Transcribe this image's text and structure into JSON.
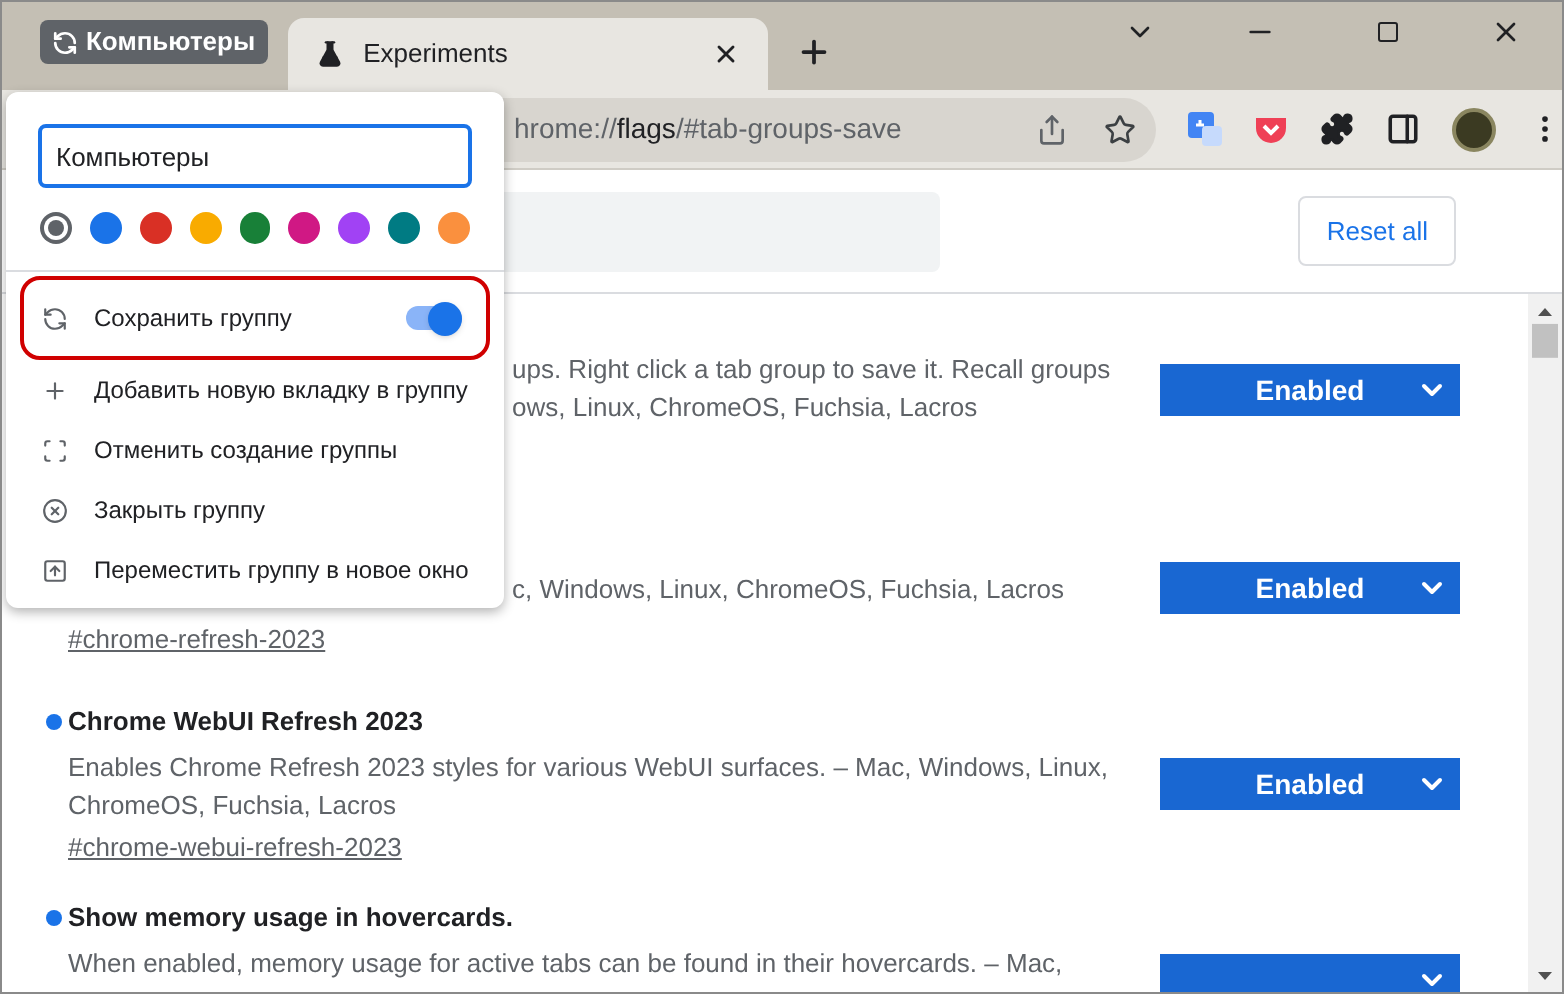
{
  "tab_group": {
    "label": "Компьютеры"
  },
  "tabs": [
    {
      "title": "Experiments",
      "selected": true
    }
  ],
  "address_bar": {
    "scheme_part": "hrome://",
    "page": "flags",
    "rest": "/#tab-groups-save"
  },
  "header": {
    "reset_button": "Reset all"
  },
  "flags": [
    {
      "kind": "covered",
      "lines": [
        "ups. Right click a tab group to save it. Recall groups",
        "ows, Linux, ChromeOS, Fuchsia, Lacros"
      ],
      "select": {
        "label": "Enabled"
      }
    },
    {
      "kind": "covered",
      "lines": [
        "c, Windows, Linux, ChromeOS, Fuchsia, Lacros"
      ],
      "link": "#chrome-refresh-2023",
      "select": {
        "label": "Enabled"
      }
    },
    {
      "kind": "full",
      "title": "Chrome WebUI Refresh 2023",
      "description": "Enables Chrome Refresh 2023 styles for various WebUI surfaces. – Mac, Windows, Linux, ChromeOS, Fuchsia, Lacros",
      "link": "#chrome-webui-refresh-2023",
      "select": {
        "label": "Enabled"
      }
    },
    {
      "kind": "full",
      "title": "Show memory usage in hovercards.",
      "description": "When enabled, memory usage for active tabs can be found in their hovercards. – Mac,"
    }
  ],
  "group_menu": {
    "name_field": {
      "value": "Компьютеры"
    },
    "colors": [
      {
        "color": "#5f6368",
        "selected": true
      },
      {
        "color": "#1a73e8",
        "selected": false
      },
      {
        "color": "#d93025",
        "selected": false
      },
      {
        "color": "#f9ab00",
        "selected": false
      },
      {
        "color": "#188038",
        "selected": false
      },
      {
        "color": "#d01884",
        "selected": false
      },
      {
        "color": "#a142f4",
        "selected": false
      },
      {
        "color": "#007b83",
        "selected": false
      },
      {
        "color": "#fa903e",
        "selected": false
      }
    ],
    "items": [
      {
        "kind": "toggle",
        "label": "Сохранить группу",
        "on": true,
        "highlighted": true
      },
      {
        "kind": "action",
        "label": "Добавить новую вкладку в группу"
      },
      {
        "kind": "action",
        "label": "Отменить создание группы"
      },
      {
        "kind": "action",
        "label": "Закрыть группу"
      },
      {
        "kind": "action",
        "label": "Переместить группу в новое окно"
      }
    ]
  }
}
